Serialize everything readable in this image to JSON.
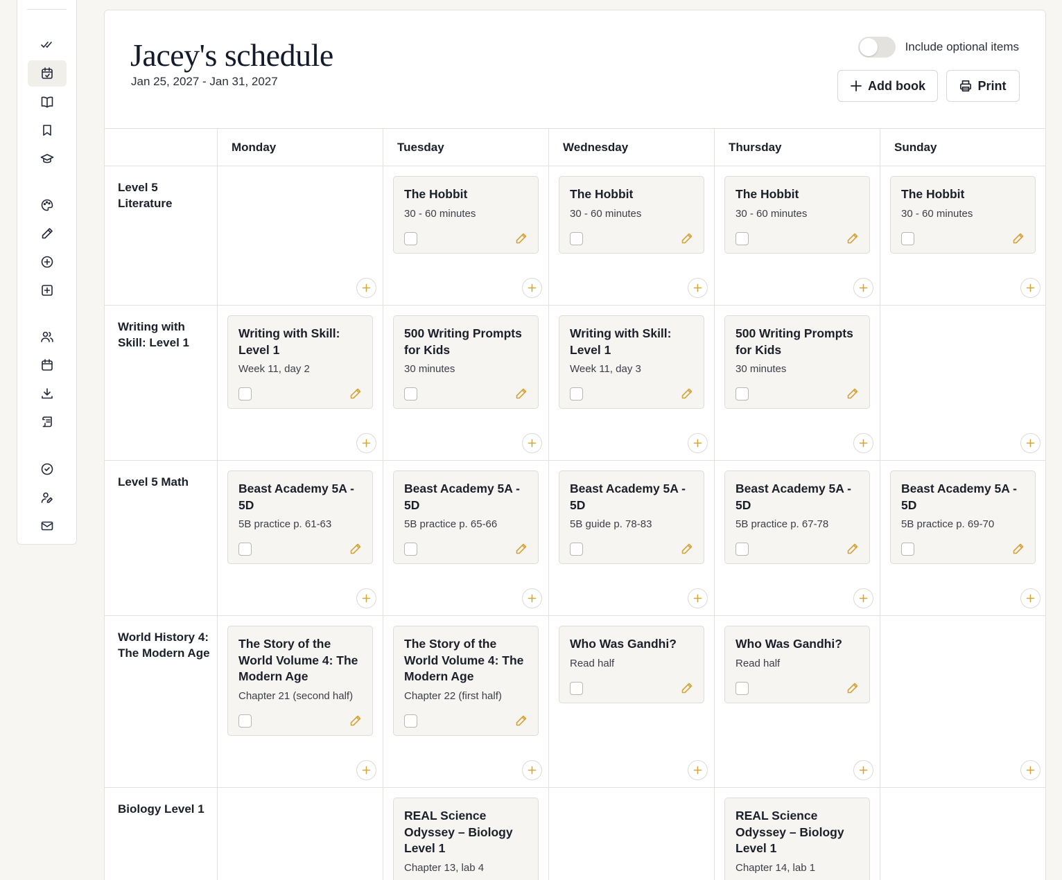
{
  "sidebar": {
    "icons": [
      "double-check-icon",
      "calendar-check-icon",
      "book-open-icon",
      "bookmark-icon",
      "graduation-cap-icon",
      "palette-icon",
      "pencil-icon",
      "plus-circle-icon",
      "plus-square-icon",
      "users-icon",
      "calendar-icon",
      "download-icon",
      "scroll-icon",
      "badge-check-icon",
      "user-edit-icon",
      "mail-icon"
    ],
    "active": "calendar-check-icon"
  },
  "header": {
    "title": "Jacey's schedule",
    "date_range": "Jan 25, 2027 - Jan 31, 2027",
    "toggle_label": "Include optional items",
    "toggle_on": false,
    "add_book_label": "Add book",
    "print_label": "Print"
  },
  "colors": {
    "accent": "#d4a33a",
    "card_bg": "#f6f5f1",
    "border": "#e3e1dc"
  },
  "days": [
    "Monday",
    "Tuesday",
    "Wednesday",
    "Thursday",
    "Sunday"
  ],
  "rows": [
    {
      "subject": "Level 5 Literature",
      "cells": [
        null,
        {
          "title": "The Hobbit",
          "desc": "30 - 60 minutes"
        },
        {
          "title": "The Hobbit",
          "desc": "30 - 60 minutes"
        },
        {
          "title": "The Hobbit",
          "desc": "30 - 60 minutes"
        },
        {
          "title": "The Hobbit",
          "desc": "30 - 60 minutes"
        }
      ]
    },
    {
      "subject": "Writing with Skill: Level 1",
      "cells": [
        {
          "title": "Writing with Skill: Level 1",
          "desc": "Week 11, day 2"
        },
        {
          "title": "500 Writing Prompts for Kids",
          "desc": "30 minutes"
        },
        {
          "title": "Writing with Skill: Level 1",
          "desc": "Week 11, day 3"
        },
        {
          "title": "500 Writing Prompts for Kids",
          "desc": "30 minutes"
        },
        null
      ]
    },
    {
      "subject": "Level 5 Math",
      "cells": [
        {
          "title": "Beast Academy 5A - 5D",
          "desc": "5B practice p. 61-63"
        },
        {
          "title": "Beast Academy 5A - 5D",
          "desc": "5B practice p. 65-66"
        },
        {
          "title": "Beast Academy 5A - 5D",
          "desc": "5B guide p. 78-83"
        },
        {
          "title": "Beast Academy 5A - 5D",
          "desc": "5B practice p. 67-78"
        },
        {
          "title": "Beast Academy 5A - 5D",
          "desc": "5B practice p. 69-70"
        }
      ]
    },
    {
      "subject": "World History 4: The Modern Age",
      "cells": [
        {
          "title": "The Story of the World Volume 4: The Modern Age",
          "desc": "Chapter 21 (second half)"
        },
        {
          "title": "The Story of the World Volume 4: The Modern Age",
          "desc": "Chapter 22 (first half)"
        },
        {
          "title": "Who Was Gandhi?",
          "desc": "Read half"
        },
        {
          "title": "Who Was Gandhi?",
          "desc": "Read half"
        },
        null
      ]
    },
    {
      "subject": "Biology Level 1",
      "cells": [
        null,
        {
          "title": "REAL Science Odyssey – Biology Level 1",
          "desc": "Chapter 13, lab 4"
        },
        null,
        {
          "title": "REAL Science Odyssey – Biology Level 1",
          "desc": "Chapter 14, lab 1"
        },
        null
      ]
    }
  ]
}
